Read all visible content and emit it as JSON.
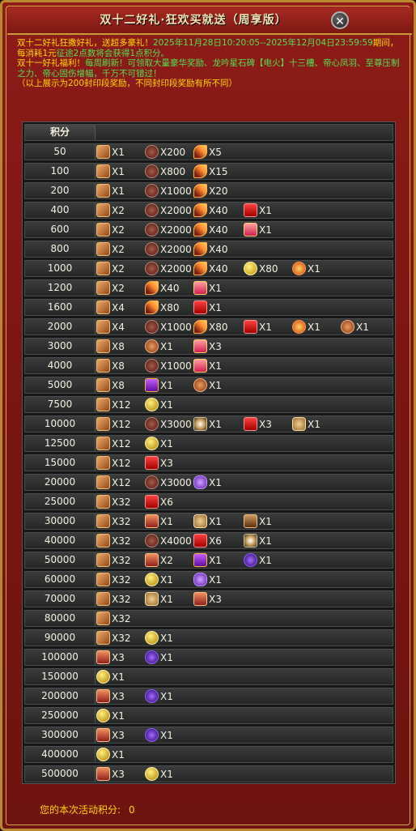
{
  "window": {
    "title": "双十二好礼·狂欢买就送（周享版）",
    "close_glyph": "✕"
  },
  "description": {
    "line1_a": "双十二好礼狂撒好礼，送超多豪礼！",
    "line1_time": "2025年11月28日10:20:05--2025年12月04日23:59:59",
    "line1_b": "期间，每消耗1元",
    "line1_c": "征途2点数将会获得1点积分。",
    "line2_a": "双十一好礼福利！",
    "line2_b": "每周刷新！可领取大量豪华奖励、龙吟星石碑【电火】十三槽、帝心凤羽、至尊压制之力、帝心固伤增幅，千万不可错过！",
    "line3": "（以上展示为200封印段奖励，不同封印段奖励有所不同）"
  },
  "table": {
    "header": "积分",
    "rows": [
      {
        "score": "50",
        "rewards": [
          {
            "icon": "scroll-icon",
            "qty": "X1"
          },
          {
            "icon": "bag-icon",
            "qty": "X200"
          },
          {
            "icon": "feather-icon",
            "qty": "X5"
          }
        ]
      },
      {
        "score": "100",
        "rewards": [
          {
            "icon": "scroll-icon",
            "qty": "X1"
          },
          {
            "icon": "bag-icon",
            "qty": "X800"
          },
          {
            "icon": "feather-icon",
            "qty": "X15"
          }
        ]
      },
      {
        "score": "200",
        "rewards": [
          {
            "icon": "scroll-icon",
            "qty": "X1"
          },
          {
            "icon": "bag-icon",
            "qty": "X1000"
          },
          {
            "icon": "feather-icon",
            "qty": "X20"
          }
        ]
      },
      {
        "score": "400",
        "rewards": [
          {
            "icon": "scroll-icon",
            "qty": "X2"
          },
          {
            "icon": "bag-icon",
            "qty": "X2000"
          },
          {
            "icon": "feather-icon",
            "qty": "X40"
          },
          {
            "icon": "redbox-icon",
            "qty": "X1"
          }
        ]
      },
      {
        "score": "600",
        "rewards": [
          {
            "icon": "scroll-icon",
            "qty": "X2"
          },
          {
            "icon": "bag-icon",
            "qty": "X2000"
          },
          {
            "icon": "feather-icon",
            "qty": "X40"
          },
          {
            "icon": "gift-icon",
            "qty": "X1"
          }
        ]
      },
      {
        "score": "800",
        "rewards": [
          {
            "icon": "scroll-icon",
            "qty": "X2"
          },
          {
            "icon": "bag-icon",
            "qty": "X2000"
          },
          {
            "icon": "feather-icon",
            "qty": "X40"
          }
        ]
      },
      {
        "score": "1000",
        "rewards": [
          {
            "icon": "scroll-icon",
            "qty": "X2"
          },
          {
            "icon": "bag-icon",
            "qty": "X2000"
          },
          {
            "icon": "feather-icon",
            "qty": "X40"
          },
          {
            "icon": "coin-icon",
            "qty": "X80"
          },
          {
            "icon": "fire-icon",
            "qty": "X1"
          }
        ]
      },
      {
        "score": "1200",
        "rewards": [
          {
            "icon": "scroll-icon",
            "qty": "X2"
          },
          {
            "icon": "feather-icon",
            "qty": "X40"
          },
          {
            "icon": "gift-icon",
            "qty": "X1"
          }
        ]
      },
      {
        "score": "1600",
        "rewards": [
          {
            "icon": "scroll-icon",
            "qty": "X4"
          },
          {
            "icon": "feather-icon",
            "qty": "X80"
          },
          {
            "icon": "redbox-icon",
            "qty": "X1"
          }
        ]
      },
      {
        "score": "2000",
        "rewards": [
          {
            "icon": "scroll-icon",
            "qty": "X4"
          },
          {
            "icon": "bag-icon",
            "qty": "X1000"
          },
          {
            "icon": "feather-icon",
            "qty": "X80"
          },
          {
            "icon": "redbox-icon",
            "qty": "X1"
          },
          {
            "icon": "fire-icon",
            "qty": "X1"
          },
          {
            "icon": "flower-icon",
            "qty": "X1"
          }
        ]
      },
      {
        "score": "3000",
        "rewards": [
          {
            "icon": "scroll-icon",
            "qty": "X8"
          },
          {
            "icon": "flower-icon",
            "qty": "X1"
          },
          {
            "icon": "gift-icon",
            "qty": "X3"
          }
        ]
      },
      {
        "score": "4000",
        "rewards": [
          {
            "icon": "scroll-icon",
            "qty": "X8"
          },
          {
            "icon": "bag-icon",
            "qty": "X1000"
          },
          {
            "icon": "gift-icon",
            "qty": "X1"
          }
        ]
      },
      {
        "score": "5000",
        "rewards": [
          {
            "icon": "scroll-icon",
            "qty": "X8"
          },
          {
            "icon": "purple-gift-icon",
            "qty": "X1"
          },
          {
            "icon": "flower-icon",
            "qty": "X1"
          }
        ]
      },
      {
        "score": "7500",
        "rewards": [
          {
            "icon": "scroll-icon",
            "qty": "X12"
          },
          {
            "icon": "gold-ball-icon",
            "qty": "X1"
          }
        ]
      },
      {
        "score": "10000",
        "rewards": [
          {
            "icon": "scroll-icon",
            "qty": "X12"
          },
          {
            "icon": "bag-icon",
            "qty": "X3000"
          },
          {
            "icon": "spark-icon",
            "qty": "X1"
          },
          {
            "icon": "redbox-icon",
            "qty": "X3"
          },
          {
            "icon": "medal-icon",
            "qty": "X1"
          }
        ]
      },
      {
        "score": "12500",
        "rewards": [
          {
            "icon": "scroll-icon",
            "qty": "X12"
          },
          {
            "icon": "gold-ball-icon",
            "qty": "X1"
          }
        ]
      },
      {
        "score": "15000",
        "rewards": [
          {
            "icon": "scroll-icon",
            "qty": "X12"
          },
          {
            "icon": "redbox-icon",
            "qty": "X3"
          }
        ]
      },
      {
        "score": "20000",
        "rewards": [
          {
            "icon": "scroll-icon",
            "qty": "X12"
          },
          {
            "icon": "bag-icon",
            "qty": "X3000"
          },
          {
            "icon": "crystal-icon",
            "qty": "X1"
          }
        ]
      },
      {
        "score": "25000",
        "rewards": [
          {
            "icon": "scroll-icon",
            "qty": "X32"
          },
          {
            "icon": "redbox-icon",
            "qty": "X6"
          }
        ]
      },
      {
        "score": "30000",
        "rewards": [
          {
            "icon": "scroll-icon",
            "qty": "X32"
          },
          {
            "icon": "card-icon",
            "qty": "X1"
          },
          {
            "icon": "medal-icon",
            "qty": "X1"
          },
          {
            "icon": "figure-icon",
            "qty": "X1"
          }
        ]
      },
      {
        "score": "40000",
        "rewards": [
          {
            "icon": "scroll-icon",
            "qty": "X32"
          },
          {
            "icon": "bag-icon",
            "qty": "X4000"
          },
          {
            "icon": "redbox-icon",
            "qty": "X6"
          },
          {
            "icon": "spark-icon",
            "qty": "X1"
          }
        ]
      },
      {
        "score": "50000",
        "rewards": [
          {
            "icon": "scroll-icon",
            "qty": "X32"
          },
          {
            "icon": "card-icon",
            "qty": "X2"
          },
          {
            "icon": "purple-gift-icon",
            "qty": "X1"
          },
          {
            "icon": "orb-icon",
            "qty": "X1"
          }
        ]
      },
      {
        "score": "60000",
        "rewards": [
          {
            "icon": "scroll-icon",
            "qty": "X32"
          },
          {
            "icon": "gold-ball-icon",
            "qty": "X1"
          },
          {
            "icon": "crystal-icon",
            "qty": "X1"
          }
        ]
      },
      {
        "score": "70000",
        "rewards": [
          {
            "icon": "scroll-icon",
            "qty": "X32"
          },
          {
            "icon": "medal-icon",
            "qty": "X1"
          },
          {
            "icon": "card-icon",
            "qty": "X3"
          }
        ]
      },
      {
        "score": "80000",
        "rewards": [
          {
            "icon": "scroll-icon",
            "qty": "X32"
          }
        ]
      },
      {
        "score": "90000",
        "rewards": [
          {
            "icon": "scroll-icon",
            "qty": "X32"
          },
          {
            "icon": "gold-ball-icon",
            "qty": "X1"
          }
        ]
      },
      {
        "score": "100000",
        "rewards": [
          {
            "icon": "card-icon",
            "qty": "X3"
          },
          {
            "icon": "orb-icon",
            "qty": "X1"
          }
        ]
      },
      {
        "score": "150000",
        "rewards": [
          {
            "icon": "gold-ball-icon",
            "qty": "X1"
          }
        ]
      },
      {
        "score": "200000",
        "rewards": [
          {
            "icon": "card-icon",
            "qty": "X3"
          },
          {
            "icon": "orb-icon",
            "qty": "X1"
          }
        ]
      },
      {
        "score": "250000",
        "rewards": [
          {
            "icon": "gold-ball-icon",
            "qty": "X1"
          }
        ]
      },
      {
        "score": "300000",
        "rewards": [
          {
            "icon": "card-icon",
            "qty": "X3"
          },
          {
            "icon": "orb-icon",
            "qty": "X1"
          }
        ]
      },
      {
        "score": "400000",
        "rewards": [
          {
            "icon": "gold-ball-icon",
            "qty": "X1"
          }
        ]
      },
      {
        "score": "500000",
        "rewards": [
          {
            "icon": "card-icon",
            "qty": "X3"
          },
          {
            "icon": "gold-ball-icon",
            "qty": "X1"
          }
        ]
      }
    ]
  },
  "footer": {
    "label": "您的本次活动积分:",
    "value": "0"
  }
}
